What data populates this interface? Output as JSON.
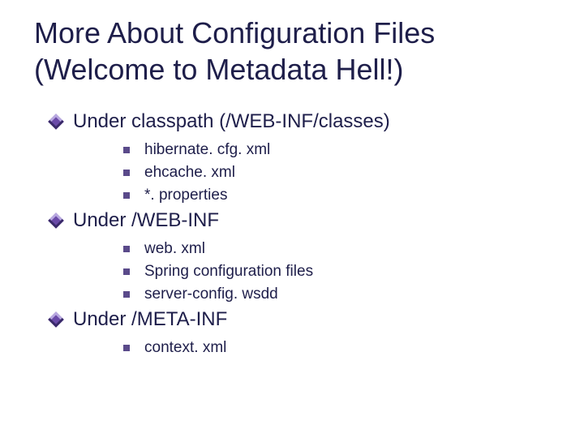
{
  "title": "More About Configuration Files (Welcome to Metadata Hell!)",
  "sections": [
    {
      "heading": "Under classpath (/WEB-INF/classes)",
      "items": [
        "hibernate. cfg. xml",
        "ehcache. xml",
        "*. properties"
      ]
    },
    {
      "heading": "Under /WEB-INF",
      "items": [
        "web. xml",
        "Spring configuration files",
        "server-config. wsdd"
      ]
    },
    {
      "heading": "Under /META-INF",
      "items": [
        "context. xml"
      ]
    }
  ]
}
